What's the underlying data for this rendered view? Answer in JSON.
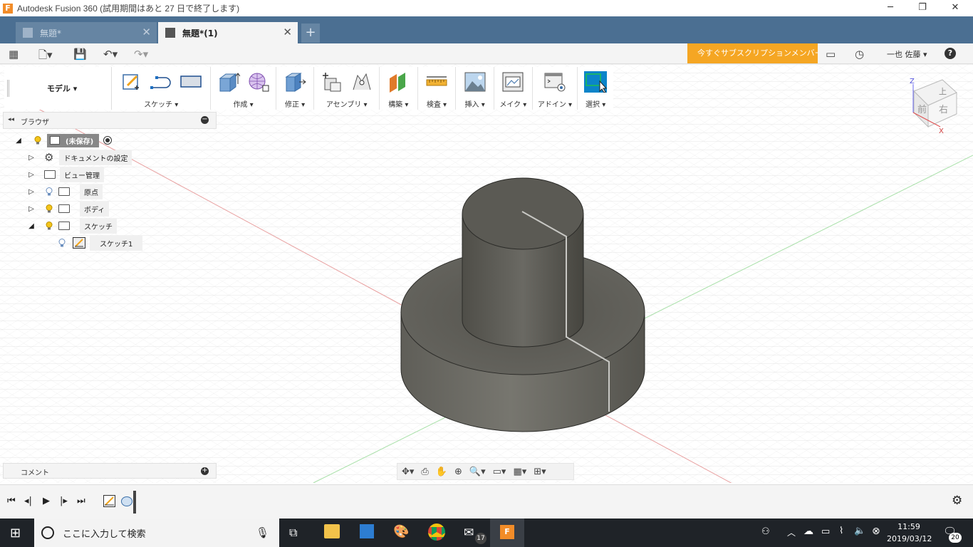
{
  "window": {
    "title": "Autodesk Fusion 360 (試用期間はあと 27 日で終了します)",
    "minimize": "─",
    "restore": "❐",
    "close": "✕"
  },
  "tabs": [
    {
      "label": "無題*",
      "close": "✕"
    },
    {
      "label": "無題*(1)",
      "close": "✕"
    }
  ],
  "new_tab": "+",
  "appbar": {
    "subscription_banner": "今すぐサブスクリプションメンバーに...",
    "user": "一也 佐藤 ▾",
    "help": "?"
  },
  "toolbar": {
    "workspace": "モデル ▾",
    "groups": [
      {
        "label": "スケッチ ▾"
      },
      {
        "label": "作成 ▾"
      },
      {
        "label": "修正 ▾"
      },
      {
        "label": "アセンブリ ▾"
      },
      {
        "label": "構築 ▾"
      },
      {
        "label": "検査 ▾"
      },
      {
        "label": "挿入 ▾"
      },
      {
        "label": "メイク ▾"
      },
      {
        "label": "アドイン ▾"
      },
      {
        "label": "選択 ▾"
      }
    ]
  },
  "browser": {
    "title": "ブラウザ",
    "collapse": "◂◂",
    "minus": "−",
    "tree": [
      {
        "label": "(未保存)",
        "toggle": "◢"
      },
      {
        "label": "ドキュメントの設定",
        "toggle": "▷"
      },
      {
        "label": "ビュー管理",
        "toggle": "▷"
      },
      {
        "label": "原点",
        "toggle": "▷"
      },
      {
        "label": "ボディ",
        "toggle": "▷"
      },
      {
        "label": "スケッチ",
        "toggle": "◢"
      },
      {
        "label": "スケッチ1",
        "toggle": ""
      }
    ]
  },
  "comments": {
    "title": "コメント",
    "plus": "+"
  },
  "viewcube": {
    "top": "上",
    "front": "前",
    "right": "右",
    "axis_z": "Z",
    "axis_x": "X"
  },
  "taskbar": {
    "search_placeholder": "ここに入力して検索",
    "time": "11:59",
    "date": "2019/03/12",
    "mail_badge": "17",
    "notifications": "20"
  },
  "colors": {
    "tabbar": "#4b6f92",
    "banner": "#f5a623",
    "body_top": "#5c5b55",
    "body_side": "#6b6a63",
    "select_blue": "#0b84c9"
  }
}
